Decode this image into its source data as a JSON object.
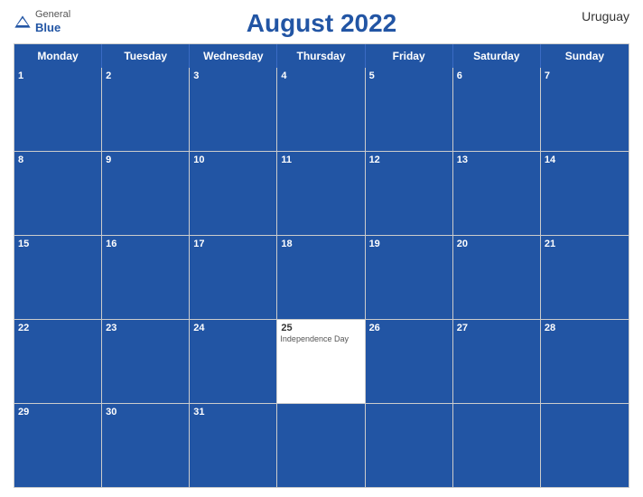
{
  "header": {
    "title": "August 2022",
    "country": "Uruguay",
    "logo": {
      "general": "General",
      "blue": "Blue"
    }
  },
  "days_of_week": [
    "Monday",
    "Tuesday",
    "Wednesday",
    "Thursday",
    "Friday",
    "Saturday",
    "Sunday"
  ],
  "weeks": [
    [
      {
        "num": "1",
        "bg": "blue",
        "event": ""
      },
      {
        "num": "2",
        "bg": "blue",
        "event": ""
      },
      {
        "num": "3",
        "bg": "blue",
        "event": ""
      },
      {
        "num": "4",
        "bg": "blue",
        "event": ""
      },
      {
        "num": "5",
        "bg": "blue",
        "event": ""
      },
      {
        "num": "6",
        "bg": "blue",
        "event": ""
      },
      {
        "num": "7",
        "bg": "blue",
        "event": ""
      }
    ],
    [
      {
        "num": "8",
        "bg": "blue",
        "event": ""
      },
      {
        "num": "9",
        "bg": "blue",
        "event": ""
      },
      {
        "num": "10",
        "bg": "blue",
        "event": ""
      },
      {
        "num": "11",
        "bg": "blue",
        "event": ""
      },
      {
        "num": "12",
        "bg": "blue",
        "event": ""
      },
      {
        "num": "13",
        "bg": "blue",
        "event": ""
      },
      {
        "num": "14",
        "bg": "blue",
        "event": ""
      }
    ],
    [
      {
        "num": "15",
        "bg": "blue",
        "event": ""
      },
      {
        "num": "16",
        "bg": "blue",
        "event": ""
      },
      {
        "num": "17",
        "bg": "blue",
        "event": ""
      },
      {
        "num": "18",
        "bg": "blue",
        "event": ""
      },
      {
        "num": "19",
        "bg": "blue",
        "event": ""
      },
      {
        "num": "20",
        "bg": "blue",
        "event": ""
      },
      {
        "num": "21",
        "bg": "blue",
        "event": ""
      }
    ],
    [
      {
        "num": "22",
        "bg": "blue",
        "event": ""
      },
      {
        "num": "23",
        "bg": "blue",
        "event": ""
      },
      {
        "num": "24",
        "bg": "blue",
        "event": ""
      },
      {
        "num": "25",
        "bg": "white",
        "event": "Independence Day"
      },
      {
        "num": "26",
        "bg": "blue",
        "event": ""
      },
      {
        "num": "27",
        "bg": "blue",
        "event": ""
      },
      {
        "num": "28",
        "bg": "blue",
        "event": ""
      }
    ],
    [
      {
        "num": "29",
        "bg": "blue",
        "event": ""
      },
      {
        "num": "30",
        "bg": "blue",
        "event": ""
      },
      {
        "num": "31",
        "bg": "blue",
        "event": ""
      },
      {
        "num": "",
        "bg": "blue",
        "event": ""
      },
      {
        "num": "",
        "bg": "blue",
        "event": ""
      },
      {
        "num": "",
        "bg": "blue",
        "event": ""
      },
      {
        "num": "",
        "bg": "blue",
        "event": ""
      }
    ]
  ]
}
